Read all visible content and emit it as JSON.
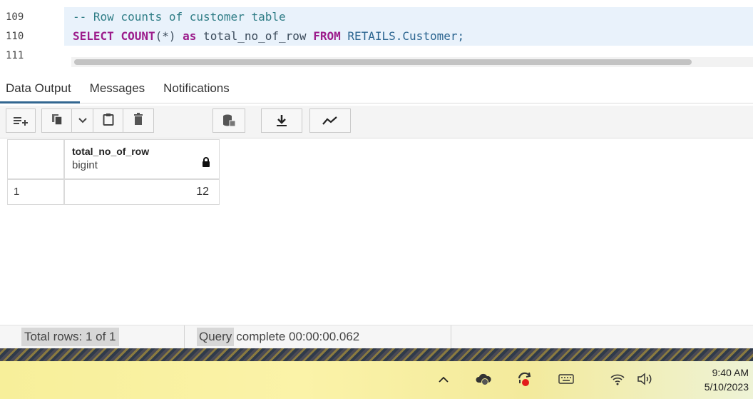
{
  "editor": {
    "lines": [
      {
        "num": "109",
        "comment": "-- Row counts of customer table"
      },
      {
        "num": "110",
        "kw_select": "SELECT",
        "kw_count": "COUNT",
        "count_arg": "(*)",
        "kw_as": "as",
        "alias": " total_no_of_row ",
        "kw_from": "FROM",
        "table": " RETAILS.Customer;"
      },
      {
        "num": "111"
      }
    ]
  },
  "tabs": [
    {
      "label": "Data Output",
      "active": true
    },
    {
      "label": "Messages",
      "active": false
    },
    {
      "label": "Notifications",
      "active": false
    }
  ],
  "toolbar": {
    "icons": [
      "add-row-icon",
      "copy-icon",
      "chevron-down-icon",
      "paste-icon",
      "delete-icon",
      "save-data-icon",
      "download-icon",
      "graph-icon"
    ]
  },
  "grid": {
    "columns": [
      {
        "name": "total_no_of_row",
        "type": "bigint"
      }
    ],
    "rows": [
      {
        "num": "1",
        "values": [
          "12"
        ]
      }
    ]
  },
  "status": {
    "total_rows": "Total rows: 1 of 1",
    "query_word": "Query",
    "query_rest": " complete 00:00:00.062"
  },
  "taskbar": {
    "time": "9:40 AM",
    "date": "5/10/2023",
    "tray_icons": [
      "chevron-up-icon",
      "onedrive-icon",
      "sync-icon",
      "keyboard-icon",
      "wifi-icon",
      "volume-icon"
    ]
  },
  "colors": {
    "keyword": "#9c1c8b",
    "comment": "#2f7d86",
    "tab_underline": "#326690"
  }
}
